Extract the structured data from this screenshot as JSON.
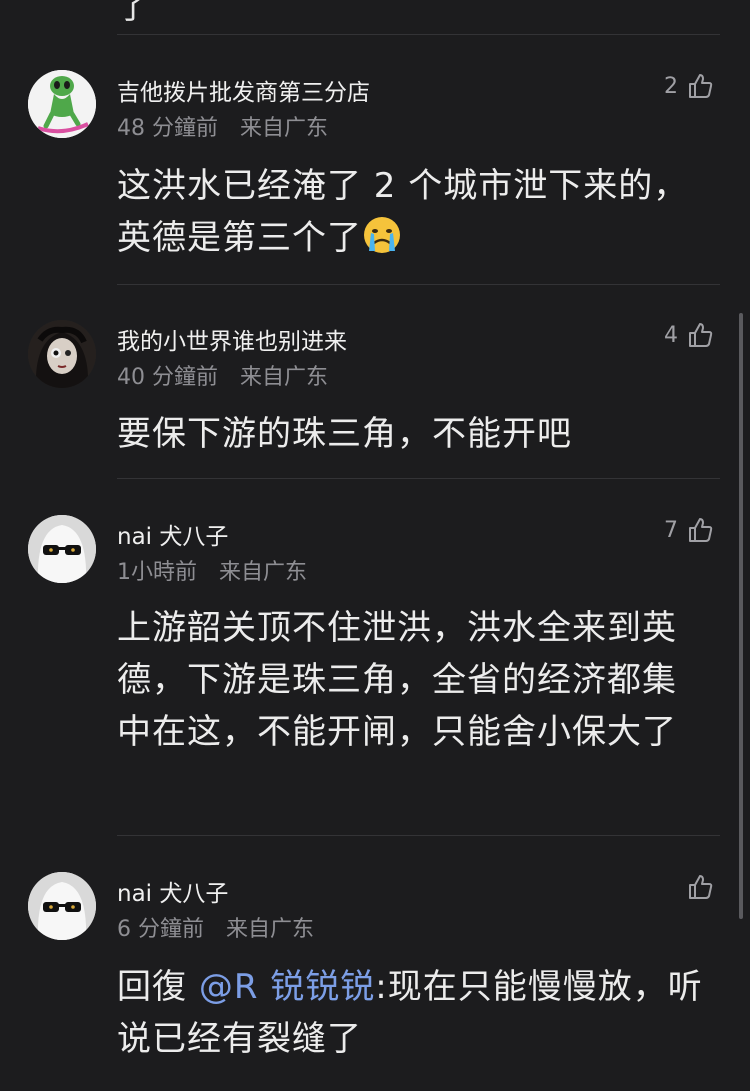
{
  "top_fragment": "了",
  "comments": [
    {
      "username": "吉他拨片批发商第三分店",
      "time": "48 分鐘前",
      "location": "来自广东",
      "likes": "2",
      "text": "这洪水已经淹了 2 个城市泄下来的，英德是第三个了",
      "emoji": "crying-face"
    },
    {
      "username": "我的小世界谁也别进来",
      "time": "40 分鐘前",
      "location": "来自广东",
      "likes": "4",
      "text": "要保下游的珠三角，不能开吧"
    },
    {
      "username": "nai 犬八子",
      "time": "1小時前",
      "location": "来自广东",
      "likes": "7",
      "text": "上游韶关顶不住泄洪，洪水全来到英德，下游是珠三角，全省的经济都集中在这，不能开闸，只能舍小保大了"
    },
    {
      "username": "nai 犬八子",
      "time": "6 分鐘前",
      "location": "来自广东",
      "likes": "",
      "reply_prefix": "回復 ",
      "mention": "@R 锐锐锐",
      "text": ":现在只能慢慢放，听说已经有裂缝了"
    }
  ],
  "colors": {
    "background": "#1c1c1e",
    "mention": "#7c9ee6",
    "meta": "#8e8e93"
  }
}
